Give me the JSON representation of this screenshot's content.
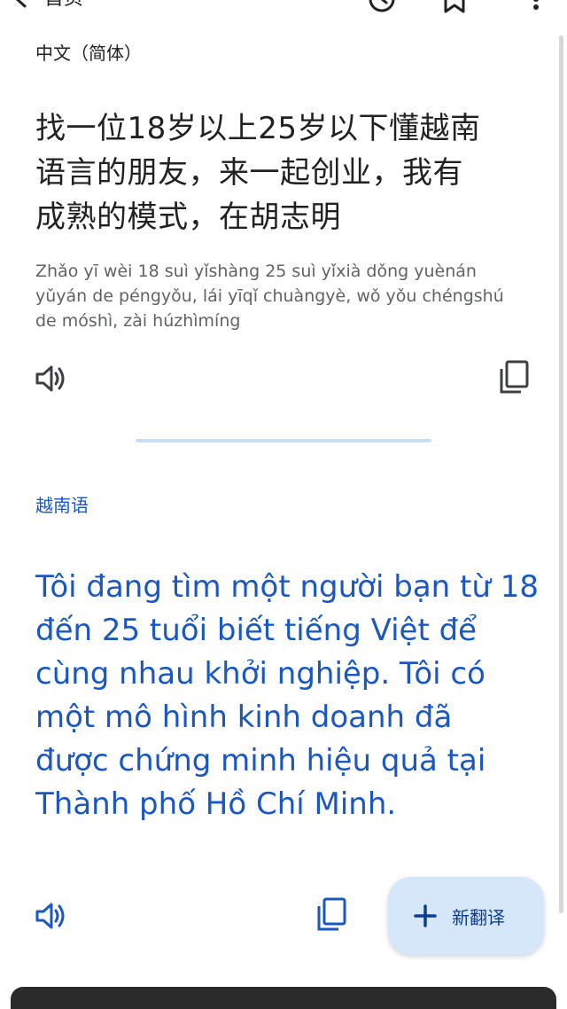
{
  "topbar": {
    "back_label": "首页",
    "icons": [
      "back-arrow-icon",
      "history-icon",
      "bookmark-icon",
      "more-vert-icon"
    ]
  },
  "source": {
    "language": "中文（简体）",
    "lines": [
      "找一位18岁以上25岁以下懂越南",
      "语言的朋友，来一起创业，我有",
      "成熟的模式，在胡志明"
    ],
    "translit_lines": [
      "Zhǎo yī wèi 18 suì yǐshàng 25 suì yǐxià dǒng yuènán",
      "yǔyán de péngyǒu, lái yīqǐ chuàngyè, wǒ yǒu chéngshú",
      "de móshì, zài húzhìmíng"
    ]
  },
  "target": {
    "language": "越南语",
    "lines": [
      "Tôi đang tìm một người bạn từ 18",
      "đến 25 tuổi biết tiếng Việt để",
      "cùng nhau khởi nghiệp. Tôi có",
      "một mô hình kinh doanh đã",
      "được chứng minh hiệu quả tại",
      "Thành phố Hồ Chí Minh."
    ]
  },
  "fab": {
    "label": "新翻译",
    "icon": "plus-icon"
  },
  "colors": {
    "accent": "#1a57c2",
    "fab_bg": "#d6e6fb",
    "text": "#202124",
    "muted": "#5f6368"
  }
}
